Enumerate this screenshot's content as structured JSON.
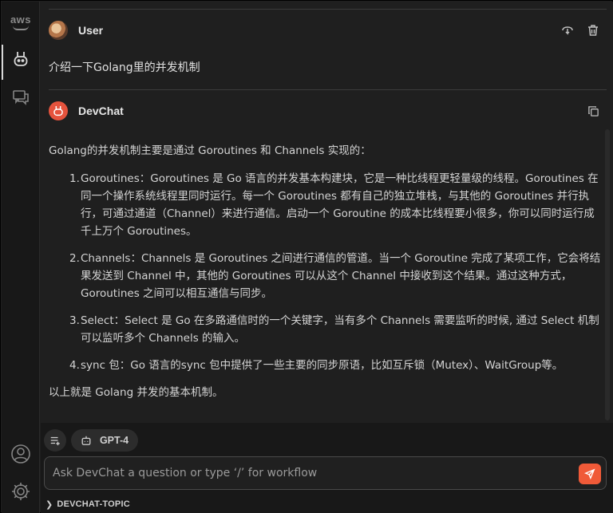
{
  "activity_bar": {
    "aws_label": "aws",
    "items": [
      {
        "name": "aws-toolkit",
        "icon": "aws-logo-icon"
      },
      {
        "name": "devchat",
        "icon": "rabbit-icon",
        "active": true
      },
      {
        "name": "chat-panel",
        "icon": "chat-bubbles-icon"
      }
    ],
    "bottom_items": [
      {
        "name": "accounts",
        "icon": "account-icon"
      },
      {
        "name": "manage",
        "icon": "gear-icon"
      }
    ]
  },
  "user_message": {
    "sender": "User",
    "text": "介绍一下Golang里的并发机制"
  },
  "bot_message": {
    "sender": "DevChat",
    "intro": "Golang的并发机制主要是通过 Goroutines 和 Channels 实现的：",
    "items": [
      {
        "num": "1.",
        "text": "Goroutines：Goroutines 是 Go 语言的并发基本构建块，它是一种比线程更轻量级的线程。Goroutines 在同一个操作系统线程里同时运行。每一个 Goroutines 都有自己的独立堆栈，与其他的 Goroutines 并行执行，可通过通道（Channel）来进行通信。启动一个 Goroutine 的成本比线程要小很多，你可以同时运行成千上万个 Goroutines。"
      },
      {
        "num": "2.",
        "text": "Channels：Channels 是 Goroutines 之间进行通信的管道。当一个 Goroutine 完成了某项工作，它会将结果发送到 Channel 中，其他的 Goroutines 可以从这个 Channel 中接收到这个结果。通过这种方式，Goroutines 之间可以相互通信与同步。"
      },
      {
        "num": "3.",
        "text": "Select：Select 是 Go 在多路通信时的一个关键字，当有多个 Channels 需要监听的时候, 通过 Select 机制可以监听多个 Channels 的输入。"
      },
      {
        "num": "4.",
        "text": "sync 包：Go 语言的sync 包中提供了一些主要的同步原语，比如互斥锁（Mutex）、WaitGroup等。"
      }
    ],
    "outro": "以上就是 Golang 并发的基本机制。"
  },
  "toolbar": {
    "model_label": "GPT-4"
  },
  "input": {
    "placeholder": "Ask DevChat a question or type ‘/’ for workflow",
    "value": ""
  },
  "topic_section": {
    "label": "DEVCHAT-TOPIC"
  },
  "colors": {
    "accent": "#f05a38",
    "background": "#1f1f1f",
    "activity_bar": "#181818"
  }
}
